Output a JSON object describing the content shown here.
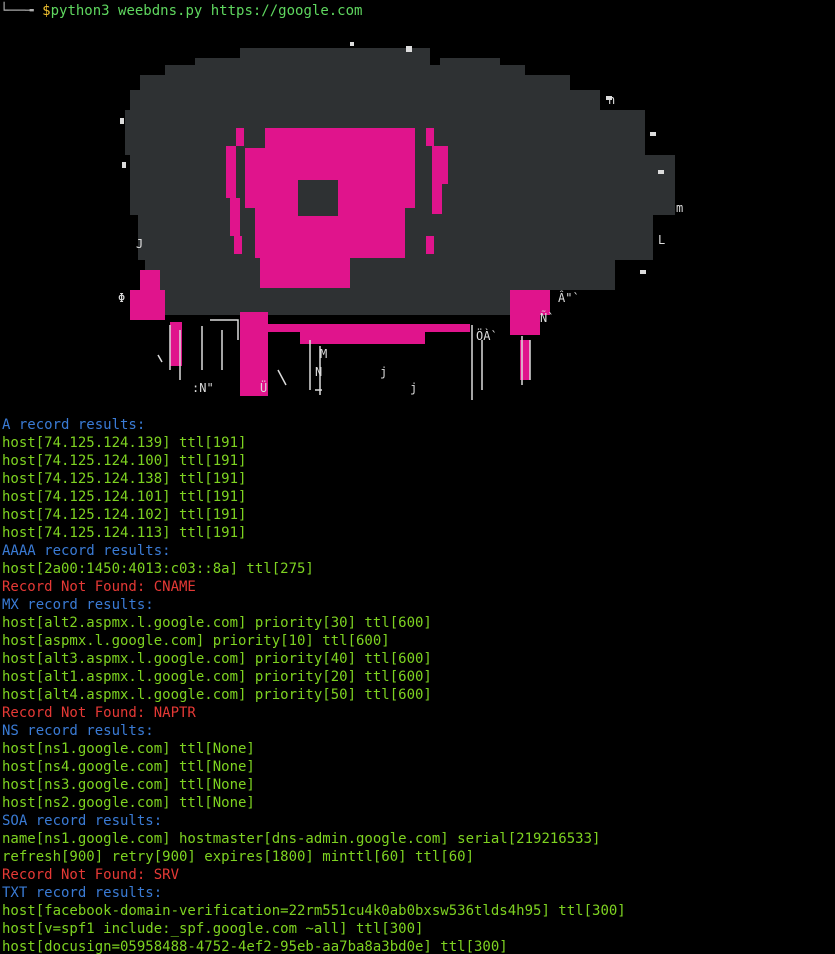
{
  "prompt": {
    "corner_glyph": "└──╼",
    "sigil": "$",
    "command": "python3 weebdns.py https://google.com"
  },
  "banner": {
    "stray_glyphs": [
      "Â\"`",
      "ÖÀ`",
      "M",
      "N",
      "j",
      ":N\"",
      "Ü",
      "Φ",
      "Ñ`",
      "J",
      "n",
      "m",
      "L"
    ]
  },
  "colors": {
    "background": "#000000",
    "header": "#3a7bd5",
    "record": "#7ed321",
    "error": "#e53935",
    "banner_gray": "#2e3133",
    "banner_magenta": "#e0148c"
  },
  "lines": [
    {
      "kind": "hdr",
      "text": "A record results:"
    },
    {
      "kind": "rec",
      "text": "host[74.125.124.139] ttl[191]"
    },
    {
      "kind": "rec",
      "text": "host[74.125.124.100] ttl[191]"
    },
    {
      "kind": "rec",
      "text": "host[74.125.124.138] ttl[191]"
    },
    {
      "kind": "rec",
      "text": "host[74.125.124.101] ttl[191]"
    },
    {
      "kind": "rec",
      "text": "host[74.125.124.102] ttl[191]"
    },
    {
      "kind": "rec",
      "text": "host[74.125.124.113] ttl[191]"
    },
    {
      "kind": "hdr",
      "text": "AAAA record results:"
    },
    {
      "kind": "rec",
      "text": "host[2a00:1450:4013:c03::8a] ttl[275]"
    },
    {
      "kind": "err",
      "text": "Record Not Found: CNAME"
    },
    {
      "kind": "hdr",
      "text": "MX record results:"
    },
    {
      "kind": "rec",
      "text": "host[alt2.aspmx.l.google.com] priority[30] ttl[600]"
    },
    {
      "kind": "rec",
      "text": "host[aspmx.l.google.com] priority[10] ttl[600]"
    },
    {
      "kind": "rec",
      "text": "host[alt3.aspmx.l.google.com] priority[40] ttl[600]"
    },
    {
      "kind": "rec",
      "text": "host[alt1.aspmx.l.google.com] priority[20] ttl[600]"
    },
    {
      "kind": "rec",
      "text": "host[alt4.aspmx.l.google.com] priority[50] ttl[600]"
    },
    {
      "kind": "err",
      "text": "Record Not Found: NAPTR"
    },
    {
      "kind": "hdr",
      "text": "NS record results:"
    },
    {
      "kind": "rec",
      "text": "host[ns1.google.com] ttl[None]"
    },
    {
      "kind": "rec",
      "text": "host[ns4.google.com] ttl[None]"
    },
    {
      "kind": "rec",
      "text": "host[ns3.google.com] ttl[None]"
    },
    {
      "kind": "rec",
      "text": "host[ns2.google.com] ttl[None]"
    },
    {
      "kind": "hdr",
      "text": "SOA record results:"
    },
    {
      "kind": "rec",
      "text": "name[ns1.google.com] hostmaster[dns-admin.google.com] serial[219216533]"
    },
    {
      "kind": "rec",
      "text": "refresh[900] retry[900] expires[1800] minttl[60] ttl[60]"
    },
    {
      "kind": "err",
      "text": "Record Not Found: SRV"
    },
    {
      "kind": "hdr",
      "text": "TXT record results:"
    },
    {
      "kind": "rec",
      "text": "host[facebook-domain-verification=22rm551cu4k0ab0bxsw536tlds4h95] ttl[300]"
    },
    {
      "kind": "rec",
      "text": "host[v=spf1 include:_spf.google.com ~all] ttl[300]"
    },
    {
      "kind": "rec",
      "text": "host[docusign=05958488-4752-4ef2-95eb-aa7ba8a3bd0e] ttl[300]"
    }
  ]
}
